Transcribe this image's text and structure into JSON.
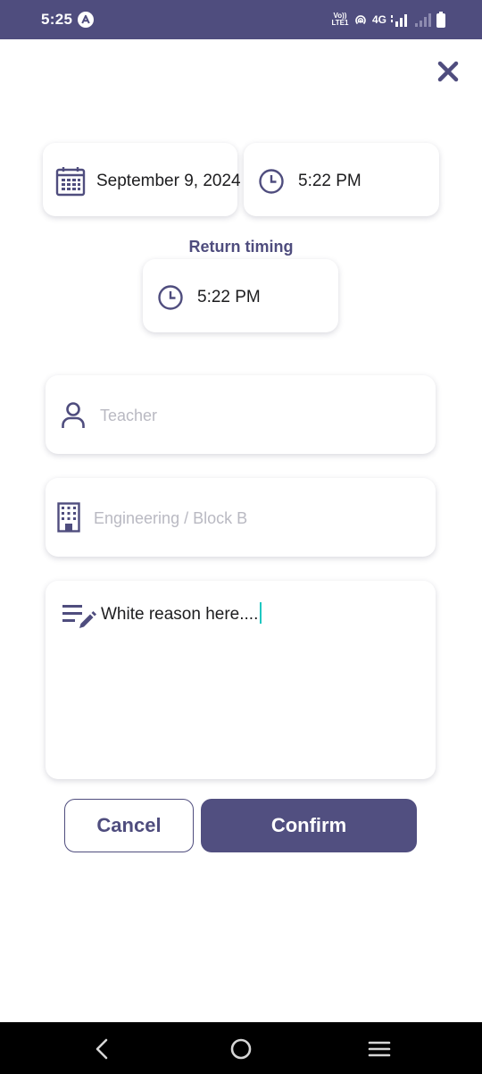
{
  "status_bar": {
    "time": "5:25",
    "volte_top": "Vo))",
    "volte_bottom": "LTE1",
    "network": "4G"
  },
  "colors": {
    "accent": "#4f4d7e",
    "caret": "#1fc7c1",
    "placeholder": "#b9b9c2"
  },
  "icons": {
    "close": "close-icon",
    "date": "calendar-icon",
    "time": "clock-icon",
    "person": "person-icon",
    "building": "building-icon",
    "notes": "notes-edit-icon"
  },
  "form": {
    "date_value": "September 9, 2024",
    "time_value": "5:22 PM",
    "return_label": "Return timing",
    "return_time_value": "5:22 PM",
    "teacher_placeholder": "Teacher",
    "location_placeholder": "Engineering / Block B",
    "reason_value": "White reason here...."
  },
  "buttons": {
    "cancel": "Cancel",
    "confirm": "Confirm"
  }
}
